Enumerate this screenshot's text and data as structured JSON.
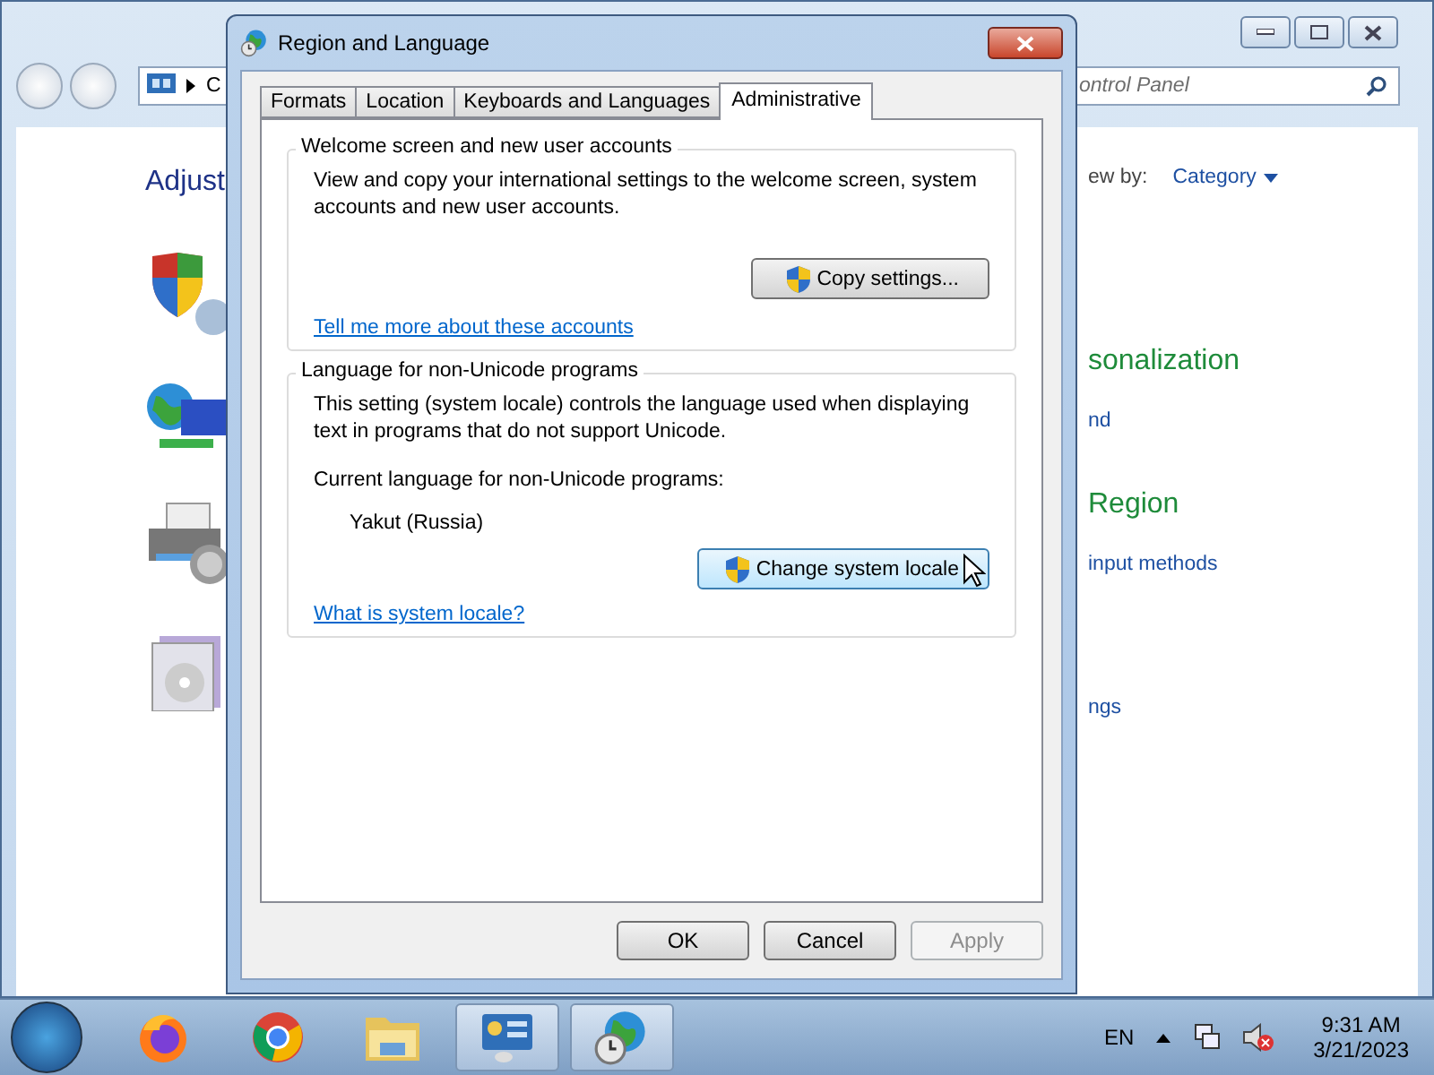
{
  "background_window": {
    "address_partial": "C",
    "search_placeholder": "ontrol Panel",
    "heading": "Adjust",
    "view_by_label": "ew by:",
    "view_by_value": "Category",
    "categories": [
      {
        "title": "sonalization",
        "links": [
          "nd"
        ]
      },
      {
        "title": "Region",
        "links": [
          "input methods"
        ]
      },
      {
        "links": [
          "ngs"
        ]
      }
    ]
  },
  "dialog": {
    "title": "Region and Language",
    "tabs": [
      {
        "label": "Formats",
        "selected": false
      },
      {
        "label": "Location",
        "selected": false
      },
      {
        "label": "Keyboards and Languages",
        "selected": false
      },
      {
        "label": "Administrative",
        "selected": true
      }
    ],
    "welcome_group": {
      "legend": "Welcome screen and new user accounts",
      "description": "View and copy your international settings to the welcome screen, system accounts and new user accounts.",
      "button": "Copy settings...",
      "link": "Tell me more about these accounts"
    },
    "locale_group": {
      "legend": "Language for non-Unicode programs",
      "description": "This setting (system locale) controls the language used when displaying text in programs that do not support Unicode.",
      "current_label": "Current language for non-Unicode programs:",
      "current_value": "Yakut (Russia)",
      "button": "Change system locale",
      "link": "What is system locale?"
    },
    "buttons": [
      {
        "label": "OK",
        "disabled": false
      },
      {
        "label": "Cancel",
        "disabled": false
      },
      {
        "label": "Apply",
        "disabled": true
      }
    ]
  },
  "taskbar": {
    "items": [
      {
        "kind": "firefox",
        "selected": false
      },
      {
        "kind": "chrome",
        "selected": false
      },
      {
        "kind": "folder",
        "selected": false
      },
      {
        "kind": "control-panel",
        "selected": true
      },
      {
        "kind": "globe-clock",
        "selected": true
      }
    ],
    "language": "EN",
    "time": "9:31 AM",
    "date": "3/21/2023"
  }
}
